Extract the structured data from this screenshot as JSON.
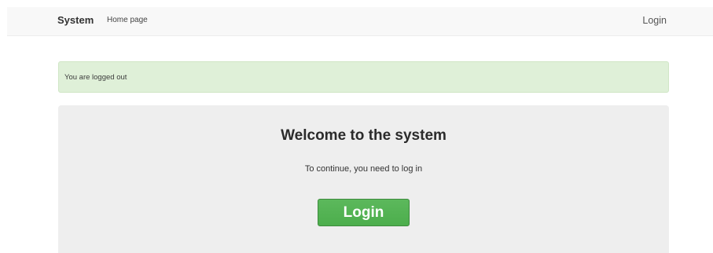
{
  "navbar": {
    "brand": "System",
    "home_link": "Home page",
    "login_link": "Login"
  },
  "alert": {
    "message": "You are logged out",
    "color": "#dff0d8"
  },
  "main": {
    "title": "Welcome to the system",
    "subtitle": "To continue, you need to log in",
    "login_button": "Login",
    "button_color": "#5cb85c"
  }
}
